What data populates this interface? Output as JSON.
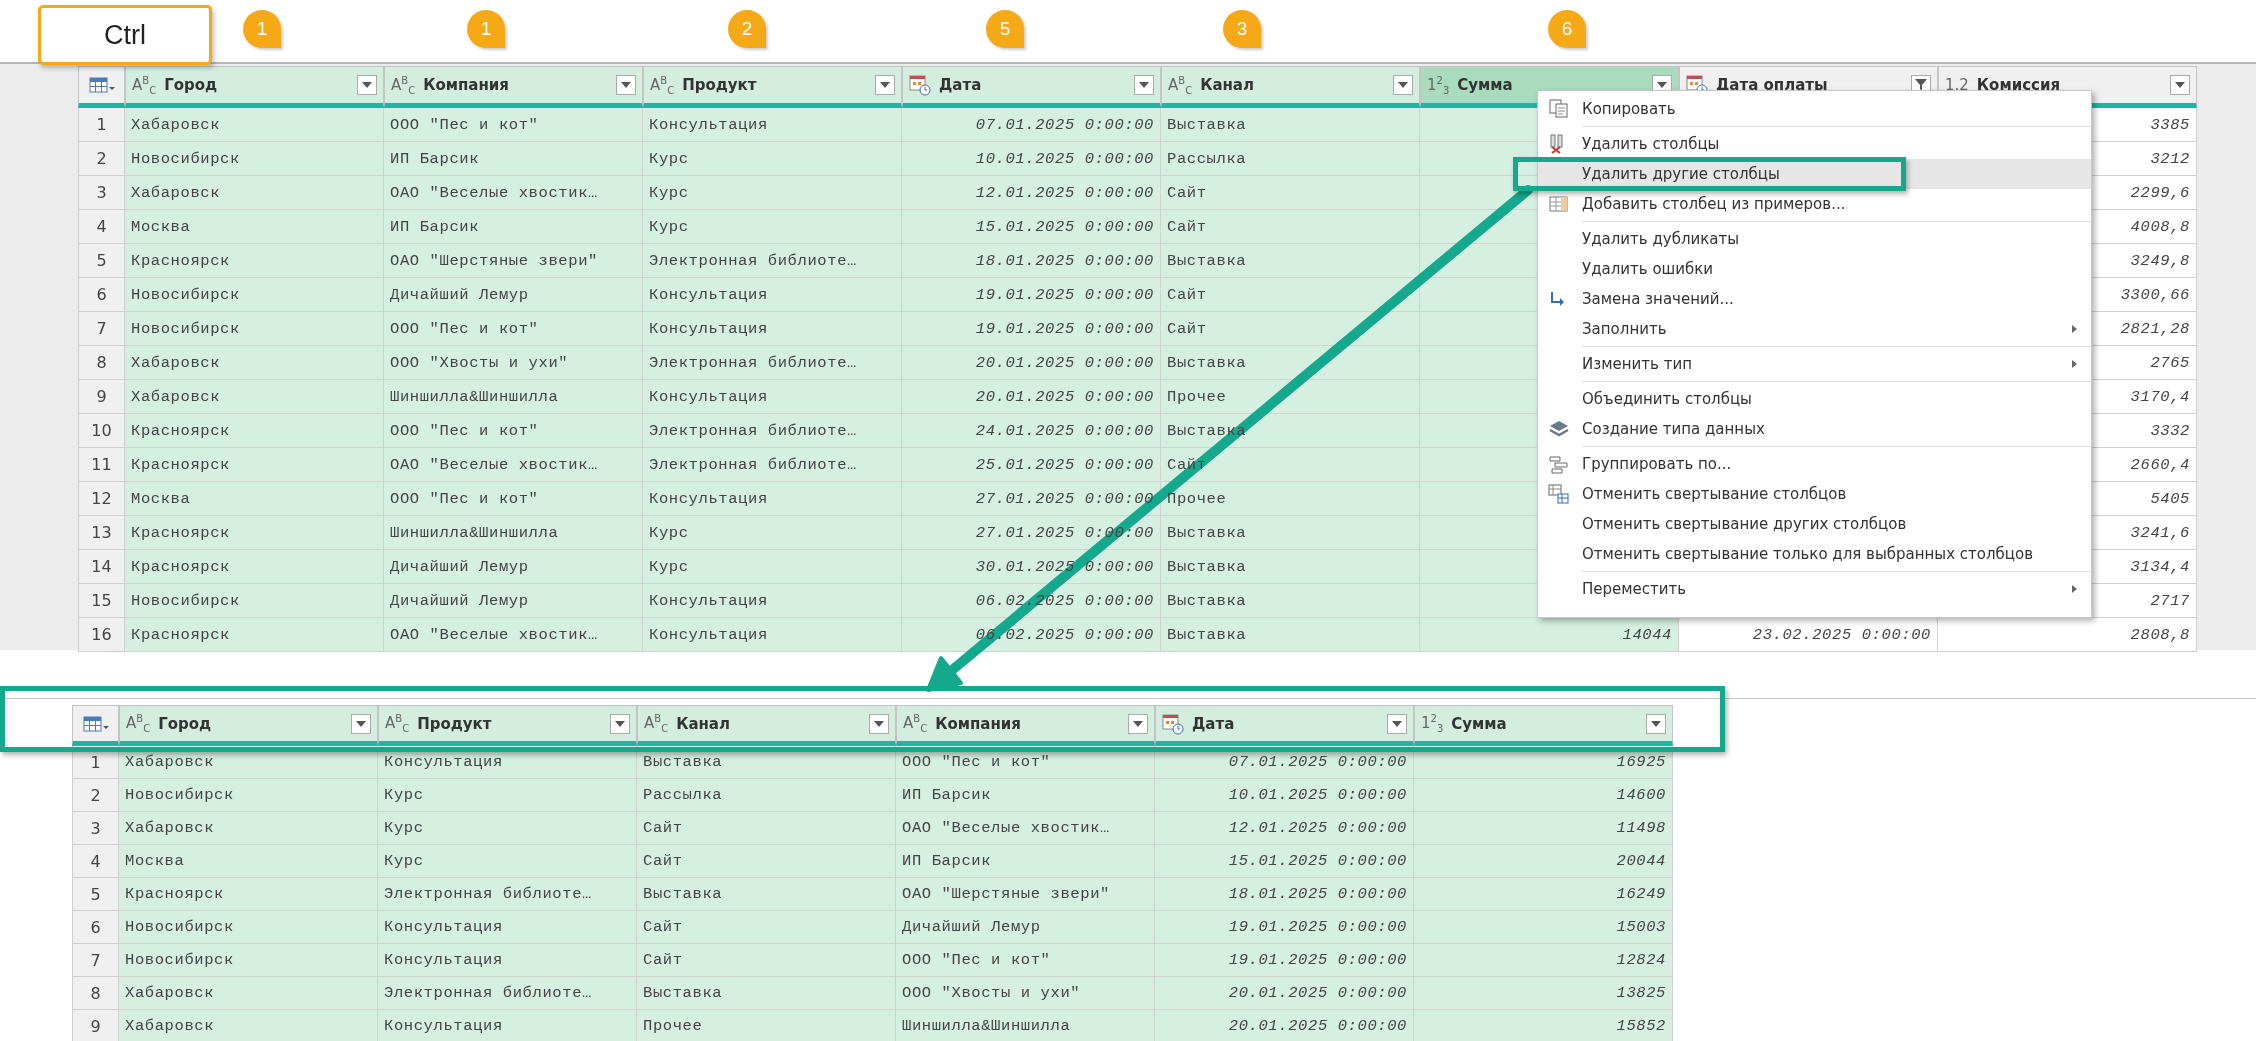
{
  "shortcut": {
    "label": "Ctrl"
  },
  "badges": [
    {
      "label": "1"
    },
    {
      "label": "1"
    },
    {
      "label": "2"
    },
    {
      "label": "5"
    },
    {
      "label": "3"
    },
    {
      "label": "6"
    }
  ],
  "source_table": {
    "columns": [
      {
        "title": "Город",
        "kind": "text",
        "type_label": "A$^{B}$$_{C}$",
        "selected": true,
        "active": false,
        "filtered": false
      },
      {
        "title": "Компания",
        "kind": "text",
        "type_label": "A$^{B}$$_{C}$",
        "selected": true,
        "active": false,
        "filtered": false
      },
      {
        "title": "Продукт",
        "kind": "text",
        "type_label": "A$^{B}$$_{C}$",
        "selected": true,
        "active": false,
        "filtered": false
      },
      {
        "title": "Дата",
        "kind": "datetime",
        "selected": true,
        "active": false,
        "filtered": false
      },
      {
        "title": "Канал",
        "kind": "text",
        "type_label": "A$^{B}$$_{C}$",
        "selected": true,
        "active": false,
        "filtered": false
      },
      {
        "title": "Сумма",
        "kind": "number",
        "type_label": "1$^{2}$$_{3}$",
        "selected": true,
        "active": true,
        "filtered": false
      },
      {
        "title": "Дата оплаты",
        "kind": "datetime",
        "selected": false,
        "active": false,
        "filtered": true
      },
      {
        "title": "Комиссия",
        "kind": "number",
        "type_label": "1.2",
        "selected": false,
        "active": false,
        "filtered": false
      }
    ],
    "rows": [
      {
        "number": "1",
        "cells": [
          "Хабаровск",
          "ООО \"Пес и кот\"",
          "Консультация",
          "07.01.2025 0:00:00",
          "Выставка",
          null,
          null,
          "3385"
        ]
      },
      {
        "number": "2",
        "cells": [
          "Новосибирск",
          "ИП Барсик",
          "Курс",
          "10.01.2025 0:00:00",
          "Рассылка",
          null,
          null,
          "3212"
        ]
      },
      {
        "number": "3",
        "cells": [
          "Хабаровск",
          "ОАО \"Веселые хвостик…",
          "Курс",
          "12.01.2025 0:00:00",
          "Сайт",
          null,
          null,
          "2299,6"
        ]
      },
      {
        "number": "4",
        "cells": [
          "Москва",
          "ИП Барсик",
          "Курс",
          "15.01.2025 0:00:00",
          "Сайт",
          null,
          null,
          "4008,8"
        ]
      },
      {
        "number": "5",
        "cells": [
          "Красноярск",
          "ОАО \"Шерстяные звери\"",
          "Электронная библиоте…",
          "18.01.2025 0:00:00",
          "Выставка",
          null,
          null,
          "3249,8"
        ]
      },
      {
        "number": "6",
        "cells": [
          "Новосибирск",
          "Дичайший Лемур",
          "Консультация",
          "19.01.2025 0:00:00",
          "Сайт",
          null,
          null,
          "3300,66"
        ]
      },
      {
        "number": "7",
        "cells": [
          "Новосибирск",
          "ООО \"Пес и кот\"",
          "Консультация",
          "19.01.2025 0:00:00",
          "Сайт",
          null,
          null,
          "2821,28"
        ]
      },
      {
        "number": "8",
        "cells": [
          "Хабаровск",
          "ООО \"Хвосты и ухи\"",
          "Электронная библиоте…",
          "20.01.2025 0:00:00",
          "Выставка",
          null,
          null,
          "2765"
        ]
      },
      {
        "number": "9",
        "cells": [
          "Хабаровск",
          "Шиншилла&Шиншилла",
          "Консультация",
          "20.01.2025 0:00:00",
          "Прочее",
          null,
          null,
          "3170,4"
        ]
      },
      {
        "number": "10",
        "cells": [
          "Красноярск",
          "ООО \"Пес и кот\"",
          "Электронная библиоте…",
          "24.01.2025 0:00:00",
          "Выставка",
          null,
          null,
          "3332"
        ]
      },
      {
        "number": "11",
        "cells": [
          "Красноярск",
          "ОАО \"Веселые хвостик…",
          "Электронная библиоте…",
          "25.01.2025 0:00:00",
          "Сайт",
          null,
          null,
          "2660,4"
        ]
      },
      {
        "number": "12",
        "cells": [
          "Москва",
          "ООО \"Пес и кот\"",
          "Консультация",
          "27.01.2025 0:00:00",
          "Прочее",
          null,
          null,
          "5405"
        ]
      },
      {
        "number": "13",
        "cells": [
          "Красноярск",
          "Шиншилла&Шиншилла",
          "Курс",
          "27.01.2025 0:00:00",
          "Выставка",
          null,
          null,
          "3241,6"
        ]
      },
      {
        "number": "14",
        "cells": [
          "Красноярск",
          "Дичайший Лемур",
          "Курс",
          "30.01.2025 0:00:00",
          "Выставка",
          null,
          null,
          "3134,4"
        ]
      },
      {
        "number": "15",
        "cells": [
          "Новосибирск",
          "Дичайший Лемур",
          "Консультация",
          "06.02.2025 0:00:00",
          "Выставка",
          null,
          null,
          "2717"
        ]
      },
      {
        "number": "16",
        "cells": [
          "Красноярск",
          "ОАО \"Веселые хвостик…",
          "Консультация",
          "06.02.2025 0:00:00",
          "Выставка",
          "14044",
          "23.02.2025 0:00:00",
          "2808,8"
        ]
      }
    ]
  },
  "context_menu": {
    "items": [
      {
        "label": "Копировать",
        "kind": "copy",
        "selected": false,
        "submenu": false,
        "separator_after": true
      },
      {
        "label": "Удалить столбцы",
        "kind": "delete",
        "selected": false,
        "submenu": false,
        "separator_after": false
      },
      {
        "label": "Удалить другие столбцы",
        "kind": "plain",
        "selected": true,
        "submenu": false,
        "separator_after": false
      },
      {
        "label": "Добавить столбец из примеров...",
        "kind": "add-column",
        "selected": false,
        "submenu": false,
        "separator_after": true
      },
      {
        "label": "Удалить дубликаты",
        "kind": "plain",
        "selected": false,
        "submenu": false,
        "separator_after": false
      },
      {
        "label": "Удалить ошибки",
        "kind": "plain",
        "selected": false,
        "submenu": false,
        "separator_after": false
      },
      {
        "label": "Замена значений...",
        "kind": "replace",
        "selected": false,
        "submenu": false,
        "separator_after": false
      },
      {
        "label": "Заполнить",
        "kind": "plain",
        "selected": false,
        "submenu": true,
        "separator_after": true
      },
      {
        "label": "Изменить тип",
        "kind": "plain",
        "selected": false,
        "submenu": true,
        "separator_after": true
      },
      {
        "label": "Объединить столбцы",
        "kind": "plain",
        "selected": false,
        "submenu": false,
        "separator_after": false
      },
      {
        "label": "Создание типа данных",
        "kind": "layers",
        "selected": false,
        "submenu": false,
        "separator_after": true
      },
      {
        "label": "Группировать по...",
        "kind": "group",
        "selected": false,
        "submenu": false,
        "separator_after": false
      },
      {
        "label": "Отменить свертывание столбцов",
        "kind": "unpivot",
        "selected": false,
        "submenu": false,
        "separator_after": false
      },
      {
        "label": "Отменить свертывание других столбцов",
        "kind": "plain",
        "selected": false,
        "submenu": false,
        "separator_after": false
      },
      {
        "label": "Отменить свертывание только для выбранных столбцов",
        "kind": "plain",
        "selected": false,
        "submenu": false,
        "separator_after": true
      },
      {
        "label": "Переместить",
        "kind": "plain",
        "selected": false,
        "submenu": true,
        "separator_after": false
      }
    ]
  },
  "result_table": {
    "columns": [
      {
        "title": "Город",
        "kind": "text",
        "type_label": "A$^{B}$$_{C}$",
        "selected": true,
        "active": false,
        "filtered": false
      },
      {
        "title": "Продукт",
        "kind": "text",
        "type_label": "A$^{B}$$_{C}$",
        "selected": true,
        "active": false,
        "filtered": false
      },
      {
        "title": "Канал",
        "kind": "text",
        "type_label": "A$^{B}$$_{C}$",
        "selected": true,
        "active": false,
        "filtered": false
      },
      {
        "title": "Компания",
        "kind": "text",
        "type_label": "A$^{B}$$_{C}$",
        "selected": true,
        "active": false,
        "filtered": false
      },
      {
        "title": "Дата",
        "kind": "datetime",
        "selected": true,
        "active": false,
        "filtered": false
      },
      {
        "title": "Сумма",
        "kind": "number",
        "type_label": "1$^{2}$$_{3}$",
        "selected": true,
        "active": false,
        "filtered": false
      }
    ],
    "rows": [
      {
        "number": "1",
        "cells": [
          "Хабаровск",
          "Консультация",
          "Выставка",
          "ООО \"Пес и кот\"",
          "07.01.2025 0:00:00",
          "16925"
        ]
      },
      {
        "number": "2",
        "cells": [
          "Новосибирск",
          "Курс",
          "Рассылка",
          "ИП Барсик",
          "10.01.2025 0:00:00",
          "14600"
        ]
      },
      {
        "number": "3",
        "cells": [
          "Хабаровск",
          "Курс",
          "Сайт",
          "ОАО \"Веселые хвостик…",
          "12.01.2025 0:00:00",
          "11498"
        ]
      },
      {
        "number": "4",
        "cells": [
          "Москва",
          "Курс",
          "Сайт",
          "ИП Барсик",
          "15.01.2025 0:00:00",
          "20044"
        ]
      },
      {
        "number": "5",
        "cells": [
          "Красноярск",
          "Электронная библиоте…",
          "Выставка",
          "ОАО \"Шерстяные звери\"",
          "18.01.2025 0:00:00",
          "16249"
        ]
      },
      {
        "number": "6",
        "cells": [
          "Новосибирск",
          "Консультация",
          "Сайт",
          "Дичайший Лемур",
          "19.01.2025 0:00:00",
          "15003"
        ]
      },
      {
        "number": "7",
        "cells": [
          "Новосибирск",
          "Консультация",
          "Сайт",
          "ООО \"Пес и кот\"",
          "19.01.2025 0:00:00",
          "12824"
        ]
      },
      {
        "number": "8",
        "cells": [
          "Хабаровск",
          "Электронная библиоте…",
          "Выставка",
          "ООО \"Хвосты и ухи\"",
          "20.01.2025 0:00:00",
          "13825"
        ]
      },
      {
        "number": "9",
        "cells": [
          "Хабаровск",
          "Консультация",
          "Прочее",
          "Шиншилла&Шиншилла",
          "20.01.2025 0:00:00",
          "15852"
        ]
      }
    ]
  }
}
